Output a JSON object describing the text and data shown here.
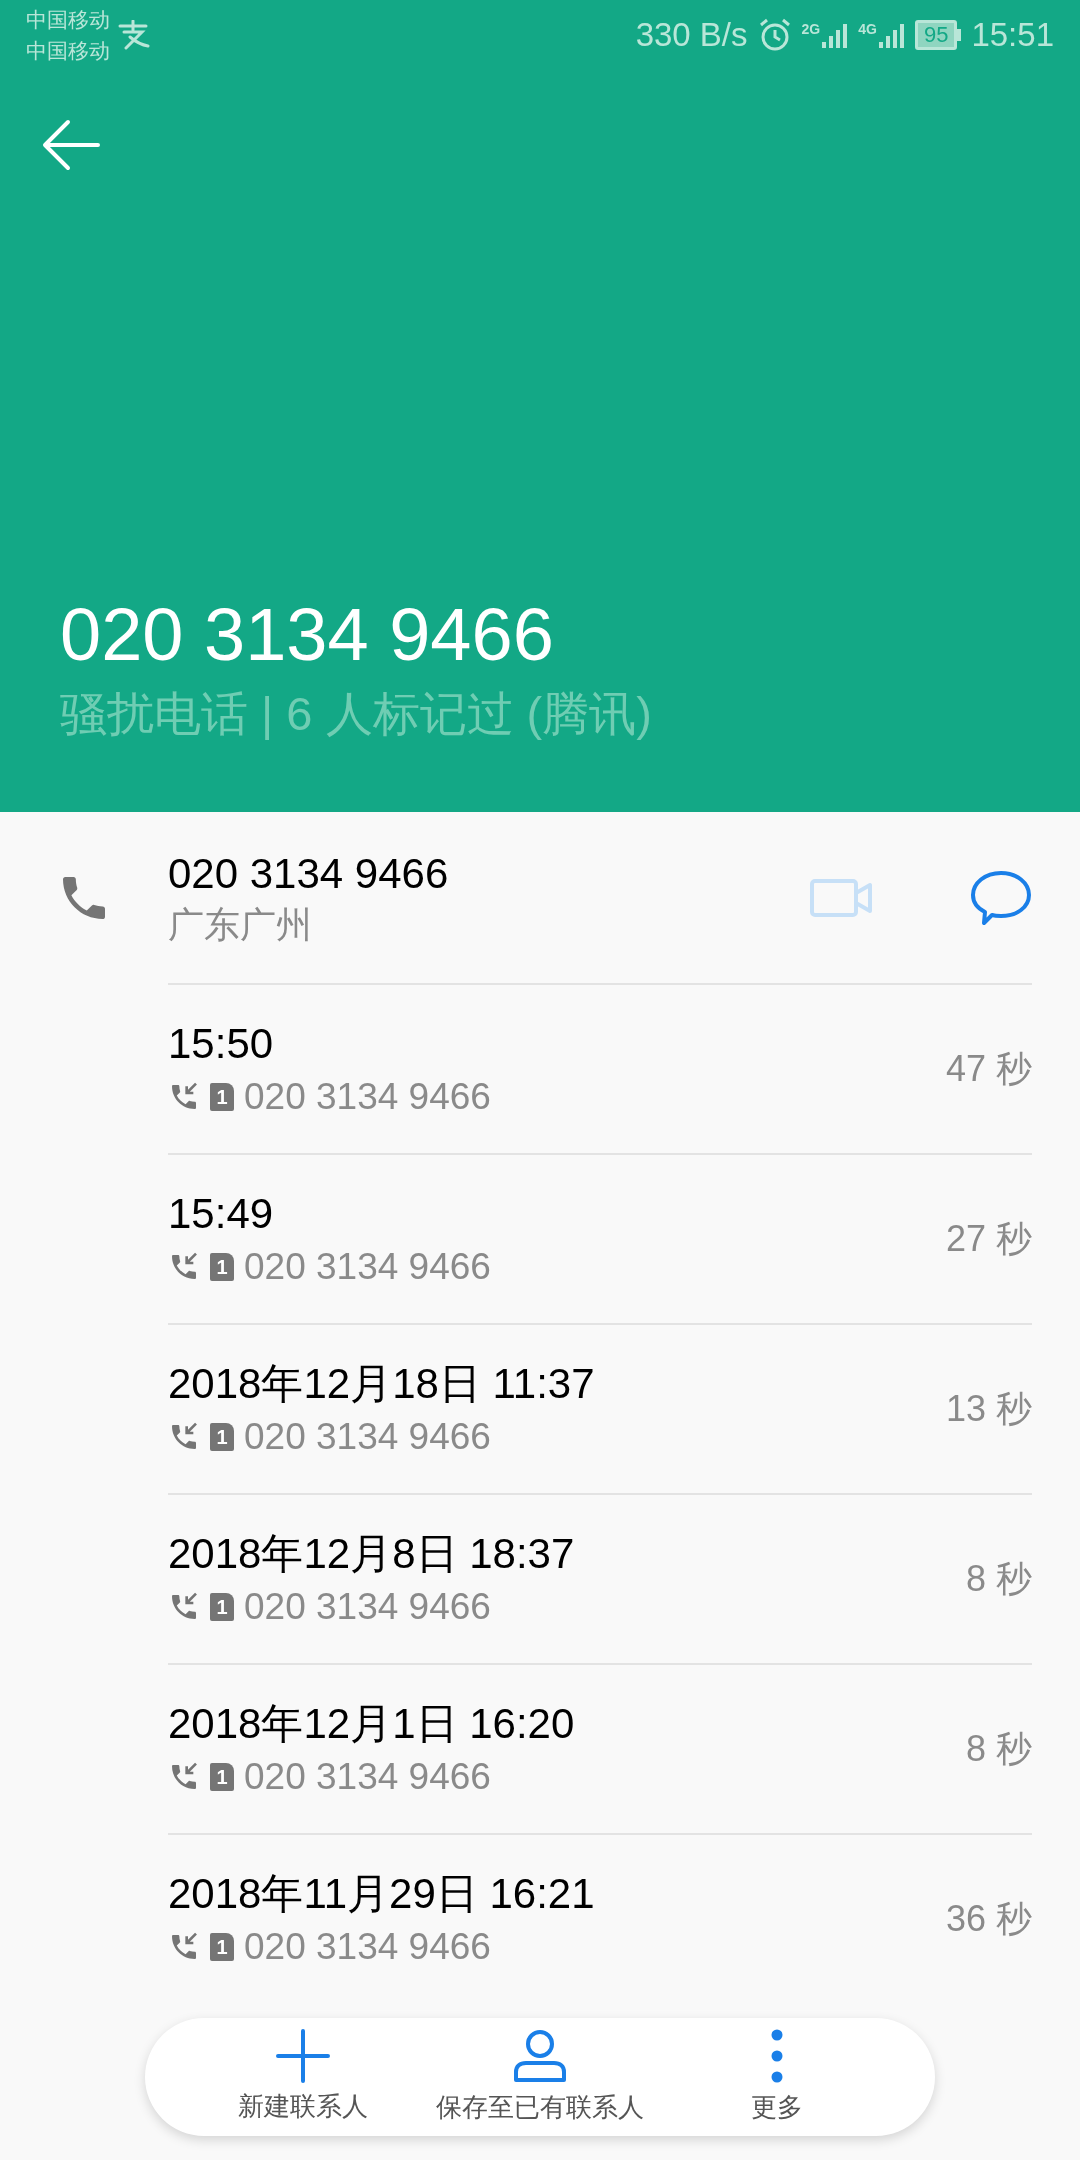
{
  "status_bar": {
    "carriers": [
      "中国移动",
      "中国移动"
    ],
    "speed": "330 B/s",
    "networks": [
      "2G",
      "4G"
    ],
    "battery": "95",
    "time": "15:51"
  },
  "header": {
    "number": "020 3134 9466",
    "tag": "骚扰电话 | 6 人标记过 (腾讯)"
  },
  "contact": {
    "number": "020 3134 9466",
    "location": "广东广州",
    "actions": [
      {
        "kind": "video",
        "disabled": true
      },
      {
        "kind": "message",
        "disabled": false
      }
    ]
  },
  "calls": [
    {
      "time": "15:50",
      "sim": "1",
      "number": "020 3134 9466",
      "duration": "47 秒"
    },
    {
      "time": "15:49",
      "sim": "1",
      "number": "020 3134 9466",
      "duration": "27 秒"
    },
    {
      "time": "2018年12月18日 11:37",
      "sim": "1",
      "number": "020 3134 9466",
      "duration": "13 秒"
    },
    {
      "time": "2018年12月8日 18:37",
      "sim": "1",
      "number": "020 3134 9466",
      "duration": "8 秒"
    },
    {
      "time": "2018年12月1日 16:20",
      "sim": "1",
      "number": "020 3134 9466",
      "duration": "8 秒"
    },
    {
      "time": "2018年11月29日 16:21",
      "sim": "1",
      "number": "020 3134 9466",
      "duration": "36 秒"
    }
  ],
  "bottom_bar": [
    {
      "kind": "add",
      "label": "新建联系人"
    },
    {
      "kind": "person",
      "label": "保存至已有联系人"
    },
    {
      "kind": "more",
      "label": "更多"
    }
  ]
}
